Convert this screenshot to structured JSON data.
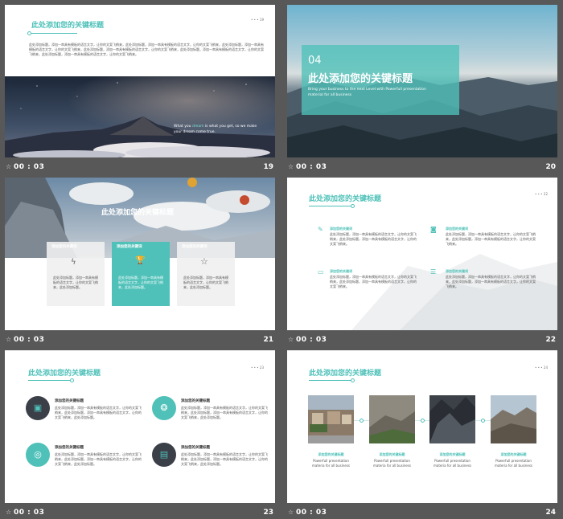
{
  "bar_duration": "00 : 03",
  "slide19": {
    "number": "19",
    "title": "此处添加您的关键标题",
    "page_tag": "• • •  19",
    "paragraph": "此处添加标题，添加一串具有模板的语言文字，让你的文案飞梢来，此处添加标题，添加一串具有模板的语言文字，让你的文案飞梢来，此处添加标题，添加一串具有模板的语言文字，让你的文案飞梢来，此处添加标题，添加一串具有模板的语言文字，让你的文案飞梢来，此处添加标题，添加一串具有模板的语言文字，让你的文案飞梢来，此处添加标题，添加一串具有模板的语言文字，让你的文案飞梢来。",
    "quote_pre": "What you ",
    "quote_dream": "dream",
    "quote_post": " is what you get, so we make your dream come true."
  },
  "slide20": {
    "number": "20",
    "big_num": "04",
    "title": "此处添加您的关键标题",
    "sub1": "Bring your business to the next Level with Powerfull presentation",
    "sub2": "material for all business"
  },
  "slide21": {
    "number": "21",
    "title": "此处添加您的关键标题",
    "cards": [
      {
        "head": "添加您的关键词",
        "icon": "ϟ",
        "text": "此处添加标题，添加一串具有模板的语言文字，让你的文案飞梢来，此处添加标题。"
      },
      {
        "head": "添加您的关键词",
        "icon": "🏆",
        "text": "此处添加标题，添加一串具有模板的语言文字，让你的文案飞梢来，此处添加标题。"
      },
      {
        "head": "添加您的关键词",
        "icon": "☆",
        "text": "此处添加标题，添加一串具有模板的语言文字，让你的文案飞梢来，此处添加标题。"
      }
    ]
  },
  "slide22": {
    "number": "22",
    "title": "此处添加您的关键标题",
    "page_tag": "• • •  22",
    "items": [
      {
        "icon": "✎",
        "head": "添加您的关键词",
        "text": "此处添加标题，添加一串具有模板的语言文字，让你的文案飞梢来，此处添加标题，添加一串具有模板的语言文字，让你的文案飞梢来。"
      },
      {
        "icon": "◙",
        "head": "添加您的关键词",
        "text": "此处添加标题，添加一串具有模板的语言文字，让你的文案飞梢来，此处添加标题，添加一串具有模板的语言文字，让你的文案飞梢来。"
      },
      {
        "icon": "▭",
        "head": "添加您的关键词",
        "text": "此处添加标题，添加一串具有模板的语言文字，让你的文案飞梢来，此处添加标题，添加一串具有模板的语言文字，让你的文案飞梢来。"
      },
      {
        "icon": "☰",
        "head": "添加您的关键词",
        "text": "此处添加标题，添加一串具有模板的语言文字，让你的文案飞梢来，此处添加标题，添加一串具有模板的语言文字，让你的文案飞梢来。"
      }
    ]
  },
  "slide23": {
    "number": "23",
    "title": "此处添加您的关键标题",
    "page_tag": "• • •  23",
    "items": [
      {
        "icon": "▣",
        "head": "添加您的关键标题",
        "text": "此处添加标题，添加一串具有模板的语言文字，让你的文案飞梢来，此处添加标题，添加一串具有模板的语言文字，让你的文案飞梢来，此处添加标题。"
      },
      {
        "icon": "❂",
        "head": "添加您的关键标题",
        "text": "此处添加标题，添加一串具有模板的语言文字，让你的文案飞梢来，此处添加标题，添加一串具有模板的语言文字，让你的文案飞梢来，此处添加标题。"
      },
      {
        "icon": "◎",
        "head": "添加您的关键标题",
        "text": "此处添加标题，添加一串具有模板的语言文字，让你的文案飞梢来，此处添加标题，添加一串具有模板的语言文字，让你的文案飞梢来，此处添加标题。"
      },
      {
        "icon": "▤",
        "head": "添加您的关键标题",
        "text": "此处添加标题，添加一串具有模板的语言文字，让你的文案飞梢来，此处添加标题，添加一串具有模板的语言文字，让你的文案飞梢来，此处添加标题。"
      }
    ]
  },
  "slide24": {
    "number": "24",
    "title": "此处添加您的关键标题",
    "page_tag": "• • •  24",
    "items": [
      {
        "head": "添加您的关键标题",
        "line1": "Powerfull presentation",
        "line2": "materia for all business"
      },
      {
        "head": "添加您的关键标题",
        "line1": "Powerfull presentation",
        "line2": "materia for all business"
      },
      {
        "head": "添加您的关键标题",
        "line1": "Powerfull presentation",
        "line2": "materia for all business"
      },
      {
        "head": "添加您的关键标题",
        "line1": "Powerfull presentation",
        "line2": "materia for all business"
      }
    ]
  },
  "colors": {
    "accent": "#4fc1b9",
    "background": "#585858",
    "dark_circle": "#3b3f48"
  }
}
